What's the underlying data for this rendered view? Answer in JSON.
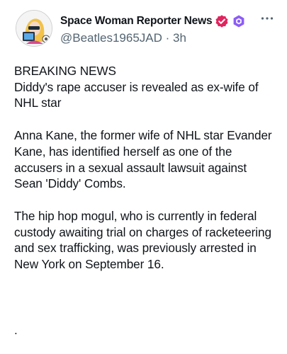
{
  "author": {
    "display_name": "Space Woman Reporter News",
    "handle": "@Beatles1965JAD",
    "separator": "·",
    "time": "3h",
    "verified_icon": "verified-check-icon",
    "affiliate_icon": "hexagon-badge-icon",
    "verified_color": "#e0245e",
    "affiliate_color": "#8b5cf6"
  },
  "more_icon": "more-dots-icon",
  "post": {
    "paragraph_1_line_1": "BREAKING NEWS",
    "paragraph_1_line_2": "Diddy's rape accuser is revealed as ex-wife of NHL star",
    "paragraph_2": "Anna Kane, the former wife of NHL star Evander Kane, has identified herself as one of the accusers in a sexual assault lawsuit against Sean 'Diddy' Combs.",
    "paragraph_3": "The hip hop mogul, who is currently in federal custody awaiting trial on charges of racketeering and sex trafficking, was previously arrested in New York on September 16.",
    "trailing_text": "."
  }
}
